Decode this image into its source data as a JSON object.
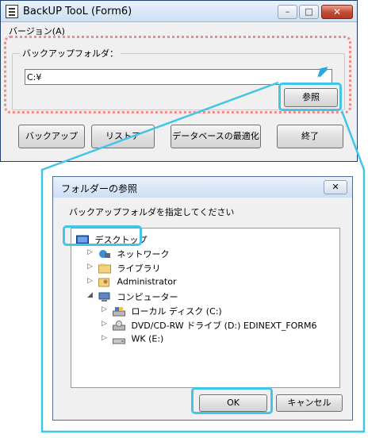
{
  "main_window": {
    "title": "BackUP TooL (Form6)",
    "menu": "バージョン(A)",
    "group_label": "バックアップフォルダ：",
    "path_value": "C:¥",
    "browse_button": "参照",
    "buttons": [
      "バックアップ",
      "リストア",
      "データベースの最適化",
      "終了"
    ],
    "controls": {
      "minimize": "–",
      "maximize": "□",
      "close": "✕"
    }
  },
  "dialog": {
    "title": "フォルダーの参照",
    "close": "✕",
    "instruction": "バックアップフォルダを指定してください",
    "tree": [
      {
        "label": "デスクトップ",
        "icon": "desktop-icon",
        "expand": ""
      },
      {
        "label": "ネットワーク",
        "icon": "network-icon",
        "expand": "▷"
      },
      {
        "label": "ライブラリ",
        "icon": "library-icon",
        "expand": "▷"
      },
      {
        "label": "Administrator",
        "icon": "user-folder-icon",
        "expand": "▷"
      },
      {
        "label": "コンピューター",
        "icon": "computer-icon",
        "expand": "◢"
      },
      {
        "label": "ローカル ディスク (C:)",
        "icon": "local-disk-icon",
        "expand": "▷"
      },
      {
        "label": "DVD/CD-RW ドライブ (D:) EDINEXT_FORM6",
        "icon": "dvd-drive-icon",
        "expand": "▷"
      },
      {
        "label": "WK (E:)",
        "icon": "usb-drive-icon",
        "expand": "▷"
      }
    ],
    "ok_button": "OK",
    "cancel_button": "キャンセル"
  },
  "colors": {
    "highlight_cyan": "#3fc6e8",
    "highlight_pink": "#f08b88"
  }
}
